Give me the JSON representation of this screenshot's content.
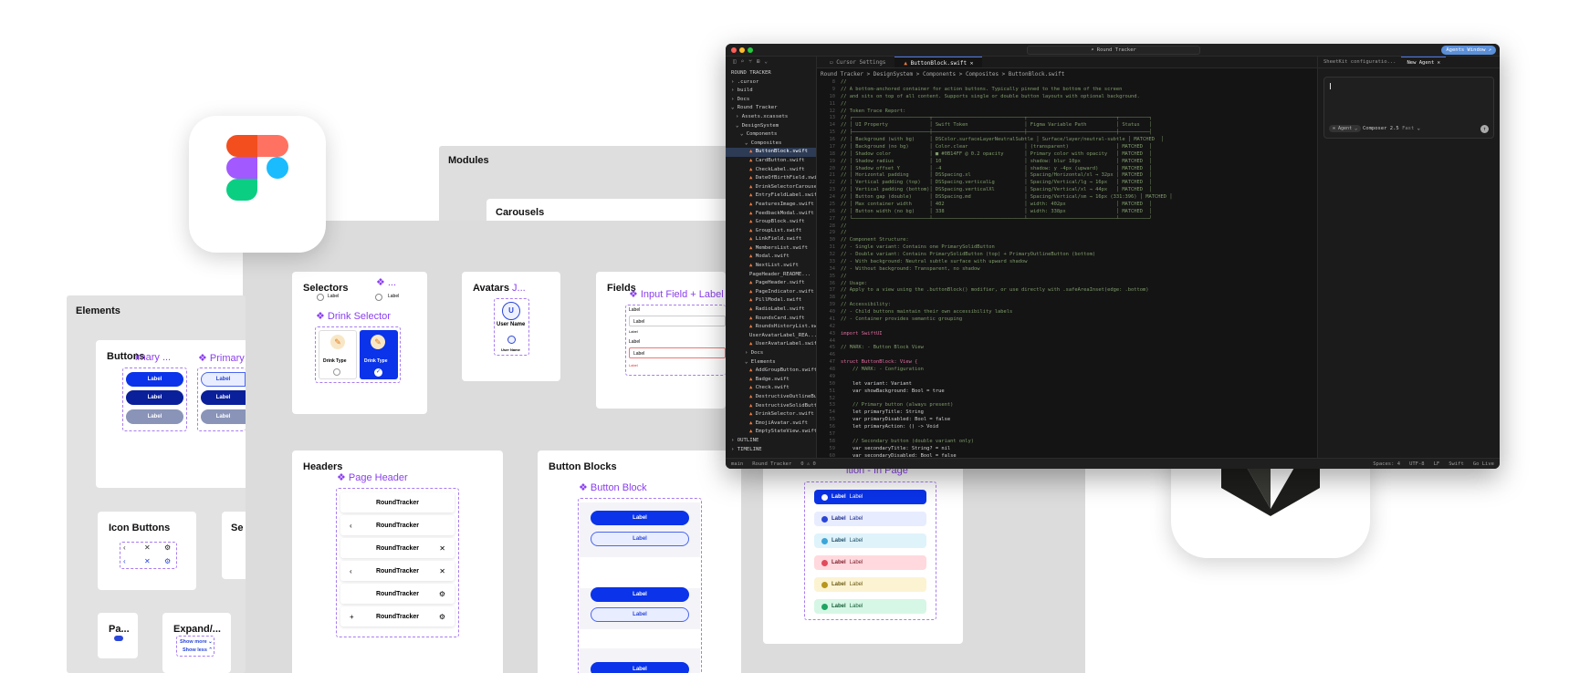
{
  "figma": {
    "modules_title": "Modules",
    "carousels_title": "Carousels",
    "elements_title": "Elements",
    "selectors": {
      "title": "Selectors",
      "comp_short": "...",
      "radio_label_1": "Label",
      "radio_label_2": "Label",
      "drink_selector": "Drink Selector",
      "drink_type_1": "Drink Type",
      "drink_type_2": "Drink Type"
    },
    "avatars": {
      "title": "Avatars",
      "comp_short": "J...",
      "initial": "U",
      "user_name": "User Name",
      "user_name_small": "User Name"
    },
    "fields": {
      "title": "Fields",
      "comp": "Input Field + Label",
      "labels": [
        "Label",
        "Label",
        "Label",
        "Label"
      ],
      "field_values": [
        "Label",
        "Label"
      ],
      "error_text": "Label"
    },
    "buttons": {
      "title": "Buttons",
      "comp_1": "imary ...",
      "comp_2": "Primary",
      "labels": [
        "Label",
        "Label",
        "Label"
      ],
      "labels_2": [
        "Label",
        "Label",
        "Label"
      ]
    },
    "icon_buttons": {
      "title": "Icon Buttons",
      "se": "Se"
    },
    "pa": {
      "title": "Pa..."
    },
    "expand": {
      "title": "Expand/...",
      "show_more": "Show more",
      "show_less": "Show less"
    },
    "headers": {
      "title": "Headers",
      "comp": "Page Header",
      "rows": [
        "RoundTracker",
        "RoundTracker",
        "RoundTracker",
        "RoundTracker",
        "RoundTracker",
        "RoundTracker"
      ]
    },
    "button_blocks": {
      "title": "Button Blocks",
      "comp": "Button Block",
      "labels": [
        "Label",
        "Label",
        "Label",
        "Label",
        "Label"
      ]
    },
    "notifications": {
      "comp": "ition - In Page",
      "rows": [
        {
          "label": "Label",
          "text": "Label",
          "bg": "#0a33ea",
          "color": "#ffffff",
          "dot": "#ffffff"
        },
        {
          "label": "Label",
          "text": "Label",
          "bg": "#e8ecff",
          "color": "#1b2a8a",
          "dot": "#2a46d8"
        },
        {
          "label": "Label",
          "text": "Label",
          "bg": "#dff3fb",
          "color": "#1f4f66",
          "dot": "#3aa6d8"
        },
        {
          "label": "Label",
          "text": "Label",
          "bg": "#ffd9de",
          "color": "#7a1f2b",
          "dot": "#e14a5c"
        },
        {
          "label": "Label",
          "text": "Label",
          "bg": "#fbf3d2",
          "color": "#6b5a12",
          "dot": "#b8961c"
        },
        {
          "label": "Label",
          "text": "Label",
          "bg": "#d6f7e5",
          "color": "#145a35",
          "dot": "#1fa562"
        }
      ]
    }
  },
  "editor": {
    "search": "Round Tracker",
    "agents_window": "Agents Window",
    "tabs": [
      "Cursor Settings",
      "ButtonBlock.swift"
    ],
    "right_tabs": [
      "SheetKit configuratio...",
      "New Agent"
    ],
    "breadcrumb": "Round Tracker > DesignSystem > Components > Composites > ButtonBlock.swift",
    "agent_label": "Agent",
    "model": "Composer 2.5",
    "model_speed": "Fast",
    "tree": [
      {
        "t": "ROUND TRACKER",
        "d": 0
      },
      {
        "t": "› .cursor",
        "d": 0
      },
      {
        "t": "› build",
        "d": 0
      },
      {
        "t": "› Docs",
        "d": 0
      },
      {
        "t": "⌄ Round Tracker",
        "d": 0
      },
      {
        "t": "› Assets.xcassets",
        "d": 1
      },
      {
        "t": "⌄ DesignSystem",
        "d": 1
      },
      {
        "t": "⌄ Components",
        "d": 2
      },
      {
        "t": "⌄ Composites",
        "d": 3
      },
      {
        "t": "ButtonBlock.swift",
        "d": 4,
        "s": 1,
        "sel": 1
      },
      {
        "t": "CardButton.swift",
        "d": 4,
        "s": 1
      },
      {
        "t": "CheckLabel.swift",
        "d": 4,
        "s": 1
      },
      {
        "t": "DateOfBirthField.swift",
        "d": 4,
        "s": 1
      },
      {
        "t": "DrinkSelectorCarousel...",
        "d": 4,
        "s": 1
      },
      {
        "t": "EntryFieldLabel.swift",
        "d": 4,
        "s": 1
      },
      {
        "t": "FeaturesImage.swift",
        "d": 4,
        "s": 1
      },
      {
        "t": "FeedbackModal.swift",
        "d": 4,
        "s": 1
      },
      {
        "t": "GroupBlock.swift",
        "d": 4,
        "s": 1
      },
      {
        "t": "GroupList.swift",
        "d": 4,
        "s": 1
      },
      {
        "t": "LinkField.swift",
        "d": 4,
        "s": 1
      },
      {
        "t": "MembersList.swift",
        "d": 4,
        "s": 1
      },
      {
        "t": "Modal.swift",
        "d": 4,
        "s": 1
      },
      {
        "t": "NextList.swift",
        "d": 4,
        "s": 1
      },
      {
        "t": "PageHeader_README...",
        "d": 4
      },
      {
        "t": "PageHeader.swift",
        "d": 4,
        "s": 1
      },
      {
        "t": "PageIndicator.swift",
        "d": 4,
        "s": 1
      },
      {
        "t": "PillModal.swift",
        "d": 4,
        "s": 1
      },
      {
        "t": "RadioLabel.swift",
        "d": 4,
        "s": 1
      },
      {
        "t": "RoundsCard.swift",
        "d": 4,
        "s": 1
      },
      {
        "t": "RoundsHistoryList.swift",
        "d": 4,
        "s": 1
      },
      {
        "t": "UserAvatarLabel_REA...",
        "d": 4
      },
      {
        "t": "UserAvatarLabel.swift",
        "d": 4,
        "s": 1
      },
      {
        "t": "› Docs",
        "d": 3
      },
      {
        "t": "⌄ Elements",
        "d": 3
      },
      {
        "t": "AddGroupButton.swift",
        "d": 4,
        "s": 1
      },
      {
        "t": "Badge.swift",
        "d": 4,
        "s": 1
      },
      {
        "t": "Check.swift",
        "d": 4,
        "s": 1
      },
      {
        "t": "DestructiveOutlineBut...",
        "d": 4,
        "s": 1
      },
      {
        "t": "DestructiveSolidButto...",
        "d": 4,
        "s": 1
      },
      {
        "t": "DrinkSelector.swift",
        "d": 4,
        "s": 1
      },
      {
        "t": "EmojiAvatar.swift",
        "d": 4,
        "s": 1
      },
      {
        "t": "EmptyStateView.swift",
        "d": 4,
        "s": 1
      },
      {
        "t": "› OUTLINE",
        "d": 0
      },
      {
        "t": "› TIMELINE",
        "d": 0
      }
    ],
    "code_start": 8,
    "code": [
      "//",
      "// A bottom-anchored container for action buttons. Typically pinned to the bottom of the screen",
      "// and sits on top of all content. Supports single or double button layouts with optional background.",
      "//",
      "// Token Trace Report:",
      "// ┌──────────────────────────┬───────────────────────────────┬──────────────────────────────┬──────────┐",
      "// │ UI Property              │ Swift Token                   │ Figma Variable Path          │ Status   │",
      "// ├──────────────────────────┼───────────────────────────────┼──────────────────────────────┼──────────┤",
      "// │ Background (with bg)     │ DSColor.surfaceLayerNeutralSubtle │ Surface/layer/neutral-subtle │ MATCHED  │",
      "// │ Background (no bg)       │ Color.clear                   │ (transparent)                │ MATCHED  │",
      "// │ Shadow color             │ ■ #0B14FF @ 0.2 opacity       │ Primary color with opacity   │ MATCHED  │",
      "// │ Shadow radius            │ 10                            │ shadow: blur 10px            │ MATCHED  │",
      "// │ Shadow offset Y          │ -4                            │ shadow: y -4px (upward)      │ MATCHED  │",
      "// │ Horizontal padding       │ DSSpacing.xl                  │ Spacing/Horizontal/xl → 32px │ MATCHED  │",
      "// │ Vertical padding (top)   │ DSSpacing.verticalLg          │ Spacing/Vertical/lg → 16px   │ MATCHED  │",
      "// │ Vertical padding (bottom)│ DSSpacing.verticalXl          │ Spacing/Vertical/xl → 44px   │ MATCHED  │",
      "// │ Button gap (double)      │ DSSpacing.md                  │ Spacing/Vertical/sm → 16px (331:396) │ MATCHED │",
      "// │ Max container width      │ 402                           │ width: 402px                 │ MATCHED  │",
      "// │ Button width (no bg)     │ 338                           │ width: 338px                 │ MATCHED  │",
      "// └──────────────────────────┴───────────────────────────────┴──────────────────────────────┴──────────┘",
      "//",
      "//",
      "// Component Structure:",
      "// - Single variant: Contains one PrimarySolidButton",
      "// - Double variant: Contains PrimarySolidButton (top) + PrimaryOutlineButton (bottom)",
      "// - With background: Neutral subtle surface with upward shadow",
      "// - Without background: Transparent, no shadow",
      "//",
      "// Usage:",
      "// Apply to a view using the .buttonBlock() modifier, or use directly with .safeAreaInset(edge: .bottom)",
      "//",
      "// Accessibility:",
      "// - Child buttons maintain their own accessibility labels",
      "// - Container provides semantic grouping",
      "",
      "import SwiftUI",
      "",
      "// MARK: - Button Block View",
      "",
      "struct ButtonBlock: View {",
      "    // MARK: - Configuration",
      "",
      "    let variant: Variant",
      "    var showBackground: Bool = true",
      "",
      "    // Primary button (always present)",
      "    let primaryTitle: String",
      "    var primaryDisabled: Bool = false",
      "    let primaryAction: () -> Void",
      "",
      "    // Secondary button (double variant only)",
      "    var secondaryTitle: String? = nil",
      "    var secondaryDisabled: Bool = false"
    ],
    "status_left": [
      "main",
      "Round Tracker",
      "0 ⚠ 0"
    ],
    "status_right": [
      "Spaces: 4",
      "UTF-8",
      "LF",
      "Swift",
      "Go Live"
    ]
  },
  "colors": {
    "accent": "#0a33ea",
    "component": "#8b3ff0",
    "editor_bg": "#141414"
  }
}
